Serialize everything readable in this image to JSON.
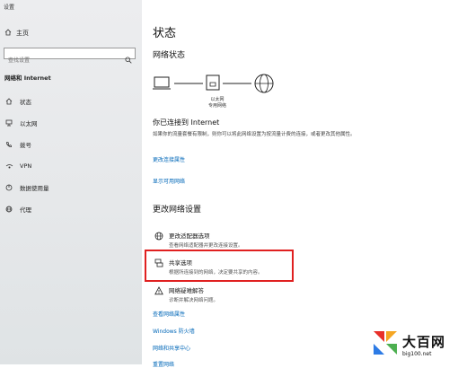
{
  "window": {
    "title": "设置"
  },
  "sidebar": {
    "home_label": "主页",
    "search_placeholder": "查找设置",
    "section_title": "网络和 Internet",
    "items": [
      {
        "label": "状态",
        "icon": "home-network-icon"
      },
      {
        "label": "以太网",
        "icon": "ethernet-icon"
      },
      {
        "label": "拨号",
        "icon": "phone-icon"
      },
      {
        "label": "VPN",
        "icon": "vpn-icon"
      },
      {
        "label": "数据使用量",
        "icon": "data-usage-icon"
      },
      {
        "label": "代理",
        "icon": "globe-icon"
      }
    ]
  },
  "main": {
    "title": "状态",
    "network_status_heading": "网络状态",
    "diagram": {
      "adapter_name": "以太网",
      "network_name": "专用网络"
    },
    "connection_status": "你已连接到 Internet",
    "connection_desc": "如果你的流量套餐有限制，则你可以将此网络设置为按流量计费的连接，或者更改其他属性。",
    "link_change_props": "更改连接属性",
    "link_show_networks": "显示可用网络",
    "change_settings_heading": "更改网络设置",
    "options": [
      {
        "title": "更改适配器选项",
        "desc": "查看网络适配器并更改连接设置。"
      },
      {
        "title": "共享选项",
        "desc": "根据所连接到的网络，决定要共享的内容。"
      },
      {
        "title": "网络疑难解答",
        "desc": "诊断并解决网络问题。"
      }
    ],
    "links_bottom": [
      "查看网络属性",
      "Windows 防火墙",
      "网络和共享中心",
      "重置网络"
    ]
  },
  "watermark": {
    "brand": "大百网",
    "url": "big100.net"
  },
  "colors": {
    "link": "#0067b8",
    "highlight": "#e02020",
    "sidebar_bg": "#e6e8ea"
  }
}
